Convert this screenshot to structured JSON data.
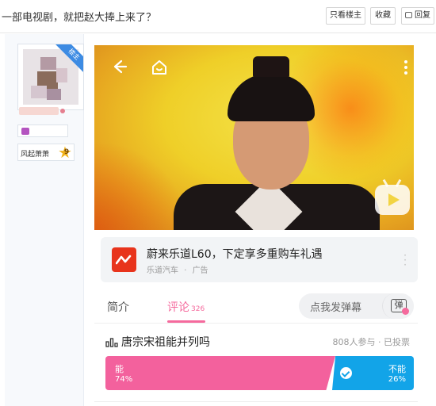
{
  "header": {
    "title": "一部电视剧，就把赵大捧上来了？",
    "buttons": {
      "only_op": "只看楼主",
      "favorite": "收藏",
      "reply": "回复"
    }
  },
  "user": {
    "ribbon": "楼主",
    "level_name": "风起萧萧",
    "level": "9"
  },
  "ad": {
    "title": "蔚来乐道L60，下定享多重购车礼遇",
    "source": "乐道汽车",
    "separator": "·",
    "tag": "广告"
  },
  "tabs": {
    "intro": "简介",
    "comments": "评论",
    "comment_count": "326",
    "danmaku_placeholder": "点我发弹幕",
    "danmaku_icon_label": "弹"
  },
  "poll": {
    "title": "唐宗宋祖能并列吗",
    "meta": "808人参与 · 已投票",
    "options": [
      {
        "label": "能",
        "percent": "74%",
        "color": "#f3619d"
      },
      {
        "label": "不能",
        "percent": "26%",
        "color": "#12a4e8",
        "selected": true
      }
    ]
  },
  "colors": {
    "accent_pink": "#f56a9d",
    "accent_blue": "#12a4e8",
    "ad_red": "#e8341c"
  }
}
